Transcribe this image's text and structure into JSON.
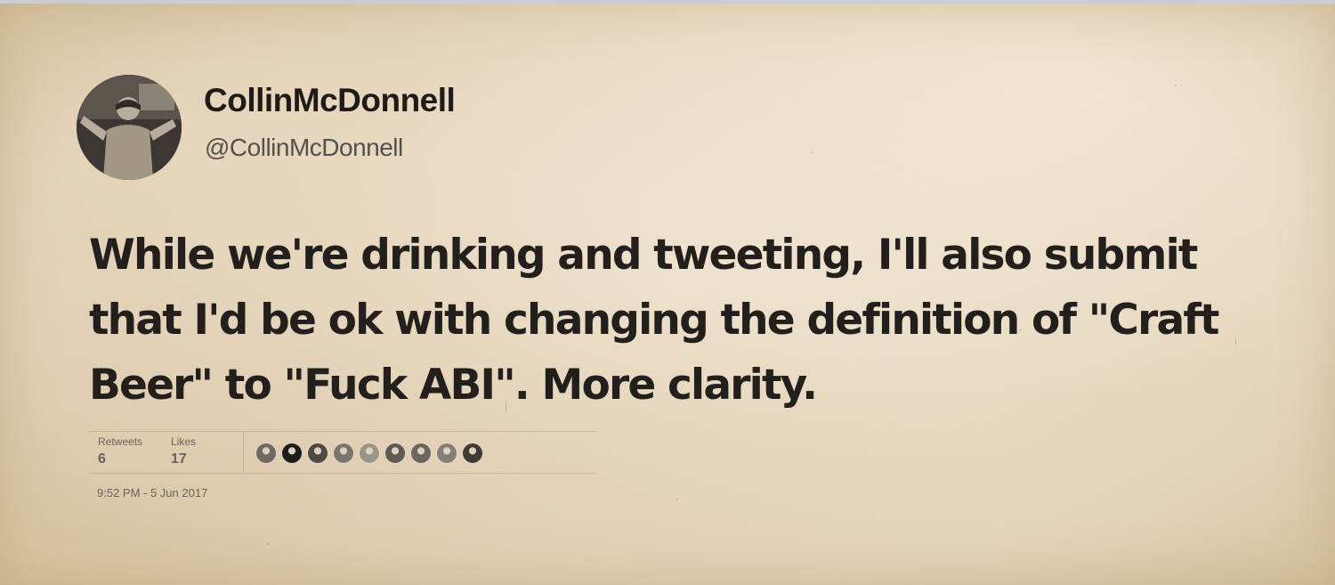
{
  "user": {
    "display_name": "CollinMcDonnell",
    "handle": "@CollinMcDonnell",
    "avatar_icon": "profile-photo"
  },
  "tweet": {
    "text": "While we're drinking and tweeting, I'll also submit that I'd be ok with changing the definition of \"Craft Beer\" to \"Fuck ABI\". More clarity."
  },
  "stats": {
    "retweets_label": "Retweets",
    "retweets_count": "6",
    "likes_label": "Likes",
    "likes_count": "17"
  },
  "likers": [
    {
      "icon": "liker-avatar",
      "color": "#6f6a63"
    },
    {
      "icon": "liker-avatar",
      "color": "#1e1c1a"
    },
    {
      "icon": "liker-avatar",
      "color": "#4d4944"
    },
    {
      "icon": "liker-avatar",
      "color": "#7a756d"
    },
    {
      "icon": "liker-avatar",
      "color": "#9a948a"
    },
    {
      "icon": "liker-avatar",
      "color": "#5e5a54"
    },
    {
      "icon": "liker-avatar",
      "color": "#6a665f"
    },
    {
      "icon": "liker-avatar",
      "color": "#858077"
    },
    {
      "icon": "liker-avatar",
      "color": "#3f3c38"
    }
  ],
  "timestamp": "9:52 PM - 5 Jun 2017",
  "colors": {
    "paper": "#eadcc6",
    "text": "#221f1c",
    "muted": "#6b6259"
  }
}
